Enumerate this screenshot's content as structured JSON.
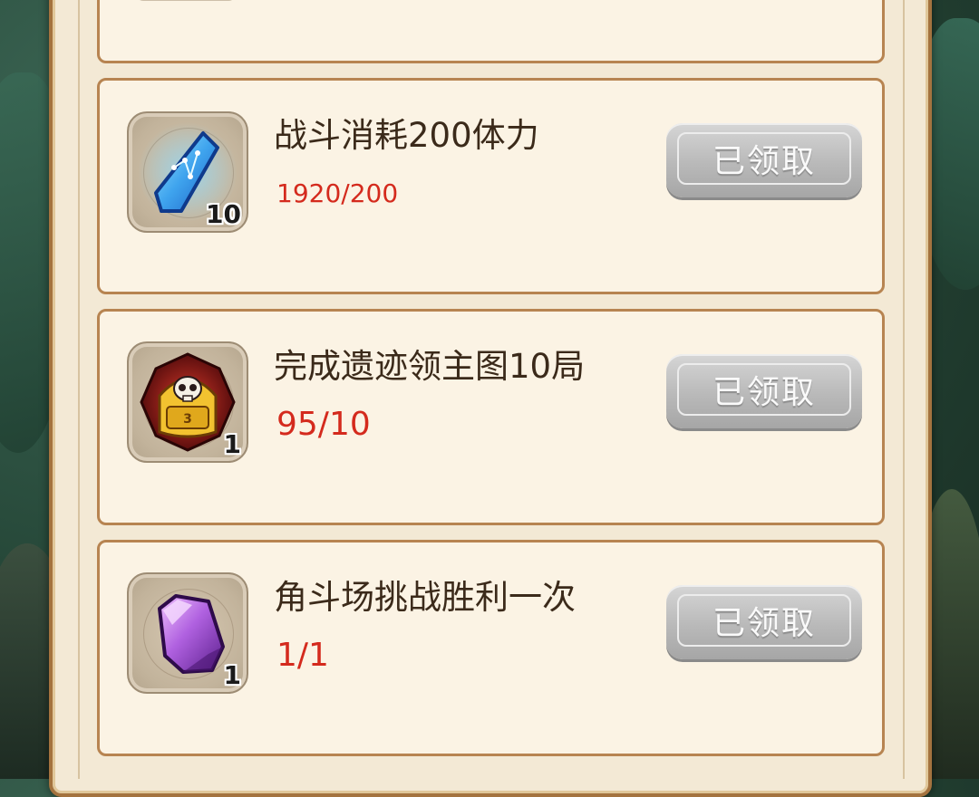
{
  "tasks": [
    {
      "title": "战斗消耗200体力",
      "progress": "1920/200",
      "reward_icon": "blue-crystal-icon",
      "reward_count": "10",
      "button_label": "已领取"
    },
    {
      "title": "完成遗迹领主图10局",
      "progress": "95/10",
      "reward_icon": "skull-chest-icon",
      "reward_count": "1",
      "button_label": "已领取"
    },
    {
      "title": "角斗场挑战胜利一次",
      "progress": "1/1",
      "reward_icon": "purple-gem-icon",
      "reward_count": "1",
      "button_label": "已领取"
    }
  ],
  "colors": {
    "progress_text": "#d42a1d",
    "title_text": "#3b2a1a",
    "card_border": "#b78451",
    "card_bg": "#fbf3e4",
    "button_disabled": "#b9b9b9"
  }
}
